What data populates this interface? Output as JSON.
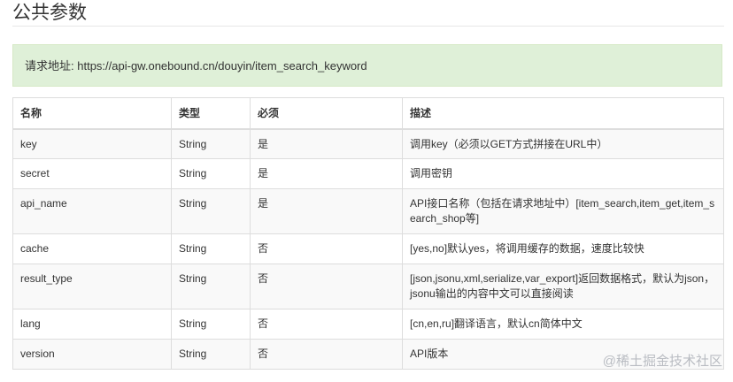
{
  "section": {
    "title": "公共参数"
  },
  "endpoint": {
    "label": "请求地址:",
    "url": "https://api-gw.onebound.cn/douyin/item_search_keyword"
  },
  "table": {
    "headers": [
      "名称",
      "类型",
      "必须",
      "描述"
    ],
    "rows": [
      {
        "name": "key",
        "type": "String",
        "required": "是",
        "desc": "调用key（必须以GET方式拼接在URL中）"
      },
      {
        "name": "secret",
        "type": "String",
        "required": "是",
        "desc": "调用密钥"
      },
      {
        "name": "api_name",
        "type": "String",
        "required": "是",
        "desc": "API接口名称（包括在请求地址中）[item_search,item_get,item_search_shop等]"
      },
      {
        "name": "cache",
        "type": "String",
        "required": "否",
        "desc": "[yes,no]默认yes，将调用缓存的数据，速度比较快"
      },
      {
        "name": "result_type",
        "type": "String",
        "required": "否",
        "desc": "[json,jsonu,xml,serialize,var_export]返回数据格式，默认为json，jsonu输出的内容中文可以直接阅读"
      },
      {
        "name": "lang",
        "type": "String",
        "required": "否",
        "desc": "[cn,en,ru]翻译语言，默认cn简体中文"
      },
      {
        "name": "version",
        "type": "String",
        "required": "否",
        "desc": "API版本"
      }
    ]
  },
  "watermark": "@稀土掘金技术社区"
}
